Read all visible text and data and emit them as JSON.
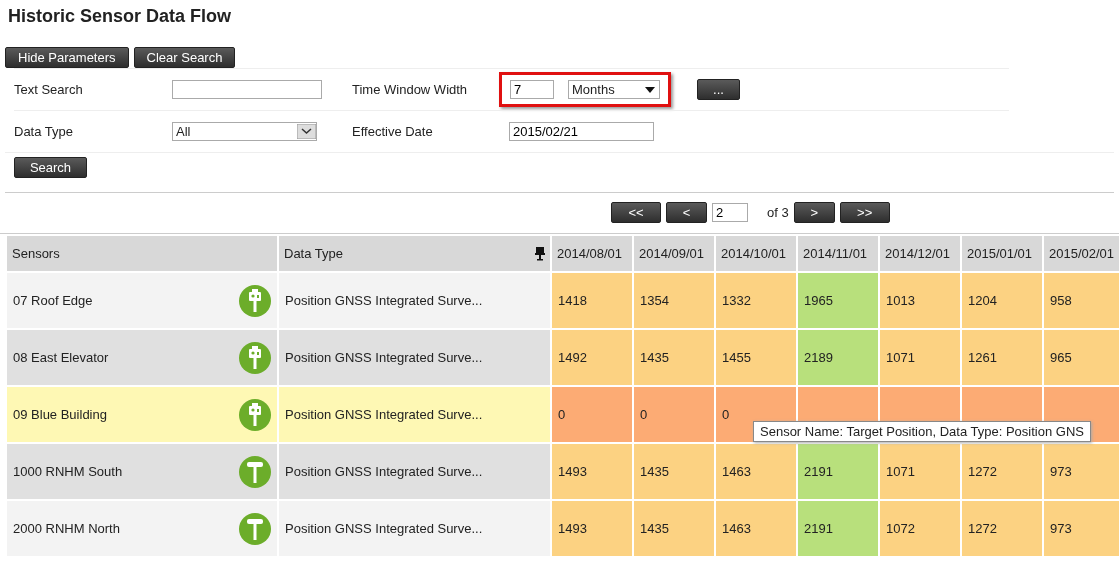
{
  "page_title": "Historic Sensor Data Flow",
  "toolbar_buttons": [
    "Hide Parameters",
    "Clear Search"
  ],
  "parameters": {
    "text_search": {
      "label": "Text Search"
    },
    "time_window": {
      "label": "Time Window Width",
      "value": "7",
      "unit": "Months",
      "highlighted": true,
      "more_button": "..."
    },
    "data_type": {
      "label": "Data Type",
      "value": "All"
    },
    "effective_date": {
      "label": "Effective Date",
      "value": "2015/02/21"
    },
    "search_button": "Search"
  },
  "pagination": {
    "first": "<<",
    "prev": "<",
    "page": "2",
    "of": "of 3",
    "next": ">",
    "last": ">>"
  },
  "table": {
    "columns": [
      "Sensors",
      "Data Type",
      "2014/08/01",
      "2014/09/01",
      "2014/10/01",
      "2014/11/01",
      "2014/12/01",
      "2015/01/01",
      "2015/02/01"
    ],
    "rows": [
      {
        "selected": false,
        "cells": [
          {
            "value": "07 Roof Edge",
            "kind": "total-station"
          },
          {
            "value": "Position GNSS Integrated Surve..."
          },
          {
            "value": "1418",
            "color": "#fcd282"
          },
          {
            "value": "1354",
            "color": "#fcd282"
          },
          {
            "value": "1332",
            "color": "#fcd282"
          },
          {
            "value": "1965",
            "color": "#b8e07c"
          },
          {
            "value": "1013",
            "color": "#fcd282"
          },
          {
            "value": "1204",
            "color": "#fcd282"
          },
          {
            "value": "958",
            "color": "#fcd282"
          }
        ]
      },
      {
        "selected": false,
        "cells": [
          {
            "value": "08 East Elevator",
            "kind": "total-station"
          },
          {
            "value": "Position GNSS Integrated Surve..."
          },
          {
            "value": "1492",
            "color": "#fcd282"
          },
          {
            "value": "1435",
            "color": "#fcd282"
          },
          {
            "value": "1455",
            "color": "#fcd282"
          },
          {
            "value": "2189",
            "color": "#b8e07c"
          },
          {
            "value": "1071",
            "color": "#fcd282"
          },
          {
            "value": "1261",
            "color": "#fcd282"
          },
          {
            "value": "965",
            "color": "#fcd282"
          }
        ]
      },
      {
        "selected": true,
        "cells": [
          {
            "value": "09 Blue Building",
            "kind": "total-station"
          },
          {
            "value": "Position GNSS Integrated Surve..."
          },
          {
            "value": "0",
            "color": "#fcab74"
          },
          {
            "value": "0",
            "color": "#fcab74"
          },
          {
            "value": "0",
            "color": "#fcab74"
          },
          {
            "color": "#fcab74"
          },
          {
            "color": "#fcab74"
          },
          {
            "color": "#fcab74"
          },
          {
            "color": "#fcab74"
          }
        ]
      },
      {
        "selected": false,
        "cells": [
          {
            "value": "1000 RNHM South",
            "kind": "gnss"
          },
          {
            "value": "Position GNSS Integrated Surve..."
          },
          {
            "value": "1493",
            "color": "#fcd282"
          },
          {
            "value": "1435",
            "color": "#fcd282"
          },
          {
            "value": "1463",
            "color": "#fcd282"
          },
          {
            "value": "2191",
            "color": "#b8e07c"
          },
          {
            "value": "1071",
            "color": "#fcd282"
          },
          {
            "value": "1272",
            "color": "#fcd282"
          },
          {
            "value": "973",
            "color": "#fcd282"
          }
        ]
      },
      {
        "selected": false,
        "cells": [
          {
            "value": "2000 RNHM North",
            "kind": "gnss"
          },
          {
            "value": "Position GNSS Integrated Surve..."
          },
          {
            "value": "1493",
            "color": "#fcd282"
          },
          {
            "value": "1435",
            "color": "#fcd282"
          },
          {
            "value": "1463",
            "color": "#fcd282"
          },
          {
            "value": "2191",
            "color": "#b8e07c"
          },
          {
            "value": "1072",
            "color": "#fcd282"
          },
          {
            "value": "1272",
            "color": "#fcd282"
          },
          {
            "value": "973",
            "color": "#fcd282"
          }
        ]
      }
    ]
  },
  "tooltip": "Sensor Name: Target Position, Data Type: Position GNS"
}
